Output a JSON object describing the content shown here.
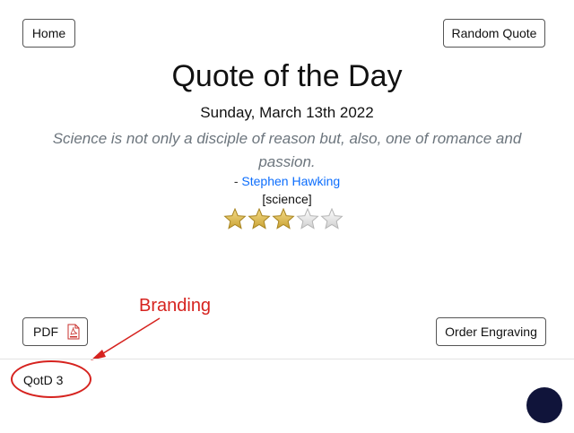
{
  "header": {
    "home_label": "Home",
    "random_label": "Random Quote"
  },
  "main": {
    "title": "Quote of the Day",
    "date": "Sunday, March 13th 2022",
    "quote": "Science is not only a disciple of reason but, also, one of romance and passion.",
    "attribution_prefix": "- ",
    "author": "Stephen Hawking",
    "tag": "[science]",
    "rating": {
      "filled": 3,
      "total": 5
    }
  },
  "actions": {
    "pdf_label": "PDF",
    "pdf_icon": "pdf-file-icon",
    "engrave_label": "Order Engraving"
  },
  "annotation": {
    "label": "Branding",
    "color": "#d6231f"
  },
  "footer": {
    "branding": "QotD 3",
    "fab_color": "#10143a"
  }
}
